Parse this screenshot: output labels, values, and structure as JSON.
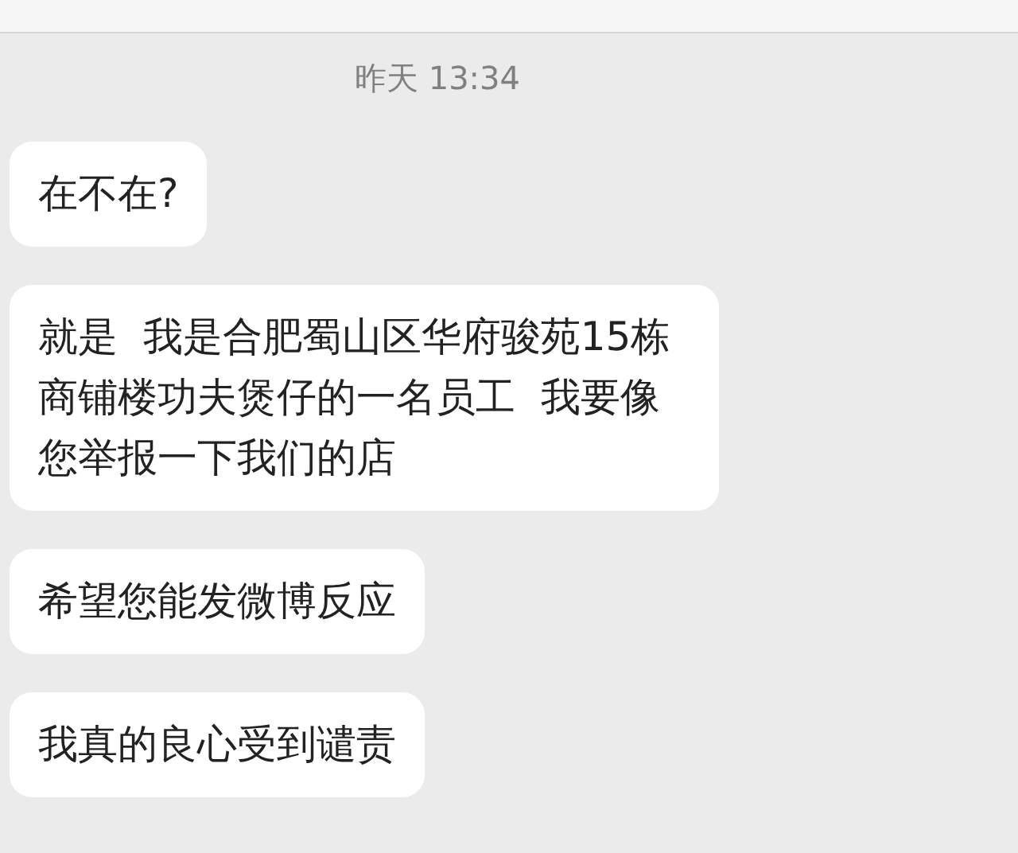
{
  "timestamp": "昨天 13:34",
  "messages": [
    {
      "text": "在不在?"
    },
    {
      "text": "就是  我是合肥蜀山区华府骏苑15栋商铺楼功夫煲仔的一名员工  我要像您举报一下我们的店"
    },
    {
      "text": "希望您能发微博反应"
    },
    {
      "text": "我真的良心受到谴责"
    }
  ]
}
